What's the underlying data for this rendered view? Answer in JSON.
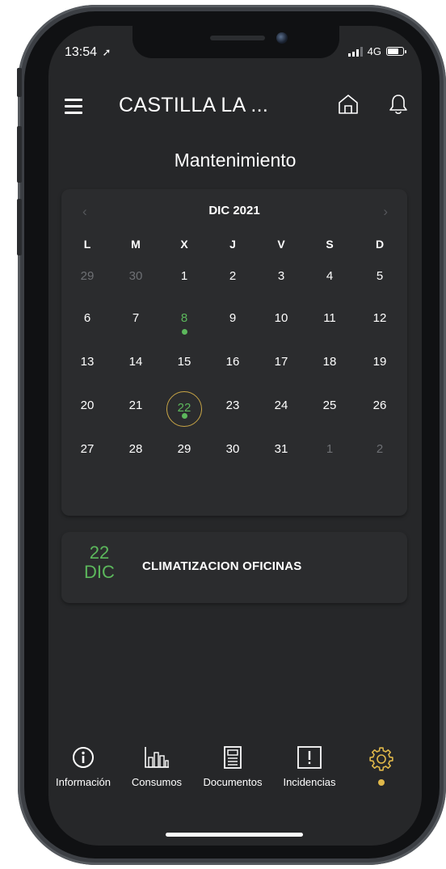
{
  "status_bar": {
    "time": "13:54",
    "network": "4G",
    "battery_level": 0.75
  },
  "header": {
    "title": "CASTILLA LA ..."
  },
  "page_title": "Mantenimiento",
  "calendar": {
    "month_label": "DIC 2021",
    "prev_symbol": "‹",
    "next_symbol": "›",
    "weekdays": [
      "L",
      "M",
      "X",
      "J",
      "V",
      "S",
      "D"
    ],
    "weeks": [
      [
        "29",
        "30",
        "1",
        "2",
        "3",
        "4",
        "5"
      ],
      [
        "6",
        "7",
        "8",
        "9",
        "10",
        "11",
        "12"
      ],
      [
        "13",
        "14",
        "15",
        "16",
        "17",
        "18",
        "19"
      ],
      [
        "20",
        "21",
        "22",
        "23",
        "24",
        "25",
        "26"
      ],
      [
        "27",
        "28",
        "29",
        "30",
        "31",
        "1",
        "2"
      ]
    ],
    "selected_day": "22",
    "event_days": [
      "8",
      "22"
    ],
    "accent_event": "#5cb85c",
    "accent_today": "#c9a646"
  },
  "event": {
    "day": "22",
    "month": "DIC",
    "name": "CLIMATIZACION OFICINAS"
  },
  "tabs": [
    {
      "label": "Información",
      "icon": "info-icon"
    },
    {
      "label": "Consumos",
      "icon": "bar-chart-icon"
    },
    {
      "label": "Documentos",
      "icon": "document-icon"
    },
    {
      "label": "Incidencias",
      "icon": "alert-icon"
    },
    {
      "label": "",
      "icon": "gear-icon",
      "active": true
    }
  ],
  "colors": {
    "background": "#262729",
    "card": "#2b2c2e",
    "active_dot": "#e0b84a"
  }
}
